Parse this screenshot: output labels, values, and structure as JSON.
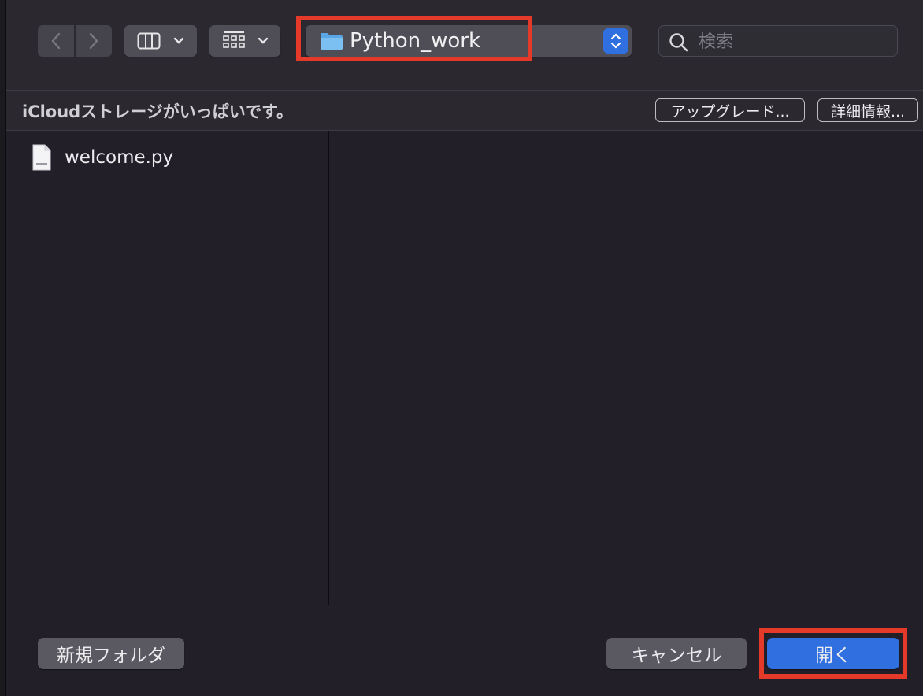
{
  "toolbar": {
    "back_label": "<",
    "forward_label": ">",
    "view_mode_icon": "column-view-icon",
    "group_icon": "grid-group-icon",
    "current_folder": "Python_work",
    "search_placeholder": "検索"
  },
  "icloud": {
    "message": "iCloudストレージがいっぱいです。",
    "upgrade_label": "アップグレード...",
    "details_label": "詳細情報..."
  },
  "files": [
    {
      "name": "welcome.py",
      "icon": "python-file-icon"
    }
  ],
  "buttons": {
    "new_folder": "新規フォルダ",
    "cancel": "キャンセル",
    "open": "開く"
  },
  "colors": {
    "accent": "#2f6fe0",
    "highlight": "#e53a2a",
    "background": "#221f28"
  }
}
